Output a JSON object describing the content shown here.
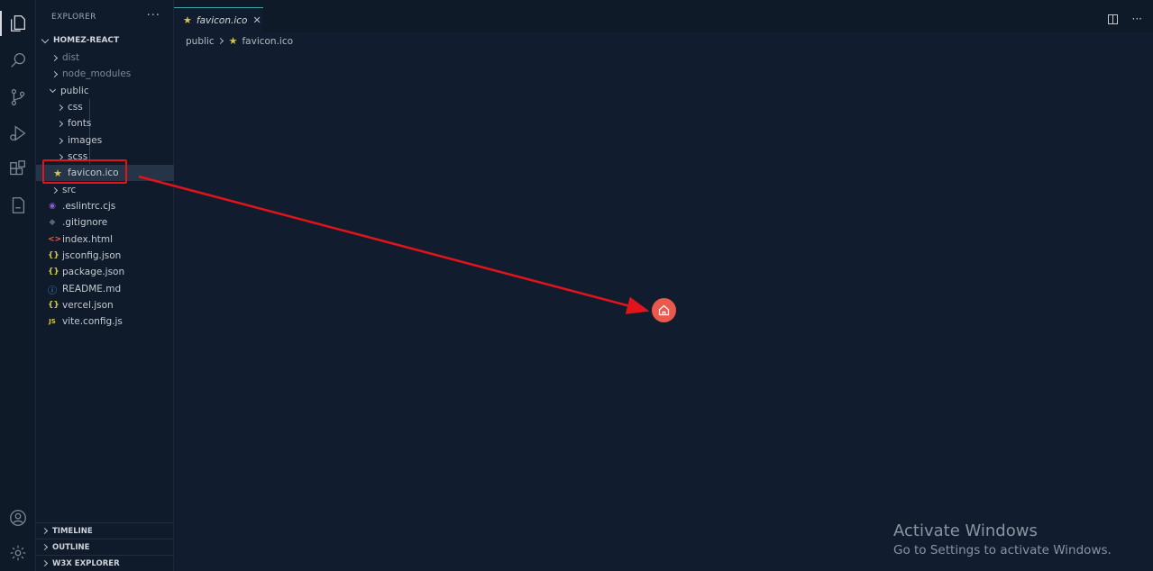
{
  "sidebar": {
    "header": "EXPLORER",
    "root": "HOMEZ-REACT",
    "items": [
      {
        "label": "dist",
        "icon": "chevron-right",
        "level": 1
      },
      {
        "label": "node_modules",
        "icon": "chevron-right",
        "level": 1
      },
      {
        "label": "public",
        "icon": "chevron-down",
        "level": 1
      },
      {
        "label": "css",
        "icon": "chevron-right",
        "level": 2
      },
      {
        "label": "fonts",
        "icon": "chevron-right",
        "level": 2
      },
      {
        "label": "images",
        "icon": "chevron-right",
        "level": 2
      },
      {
        "label": "scss",
        "icon": "chevron-right",
        "level": 2
      },
      {
        "label": "favicon.ico",
        "icon": "star-icon",
        "level": 2
      },
      {
        "label": "src",
        "icon": "chevron-right",
        "level": 1
      },
      {
        "label": ".eslintrc.cjs",
        "icon": "eslint-icon",
        "level": 1
      },
      {
        "label": ".gitignore",
        "icon": "git-icon",
        "level": 1
      },
      {
        "label": "index.html",
        "icon": "html-icon",
        "level": 1
      },
      {
        "label": "jsconfig.json",
        "icon": "json-icon",
        "level": 1
      },
      {
        "label": "package.json",
        "icon": "json-icon",
        "level": 1
      },
      {
        "label": "README.md",
        "icon": "info-icon",
        "level": 1
      },
      {
        "label": "vercel.json",
        "icon": "json-icon",
        "level": 1
      },
      {
        "label": "vite.config.js",
        "icon": "js-icon",
        "level": 1
      }
    ],
    "sections": [
      "TIMELINE",
      "OUTLINE",
      "W3X EXPLORER"
    ]
  },
  "editor": {
    "tab_label": "favicon.ico",
    "breadcrumb": [
      "public",
      "favicon.ico"
    ],
    "more_glyph": "···"
  },
  "icons": {
    "json": "{}",
    "html": "<>",
    "js": "JS",
    "info": "ⓘ"
  },
  "watermark": {
    "title": "Activate Windows",
    "subtitle": "Go to Settings to activate Windows."
  },
  "colors": {
    "highlight": "#e0141a",
    "favicon_bg": "#ea5a4c",
    "accent": "#3fa7a5"
  }
}
